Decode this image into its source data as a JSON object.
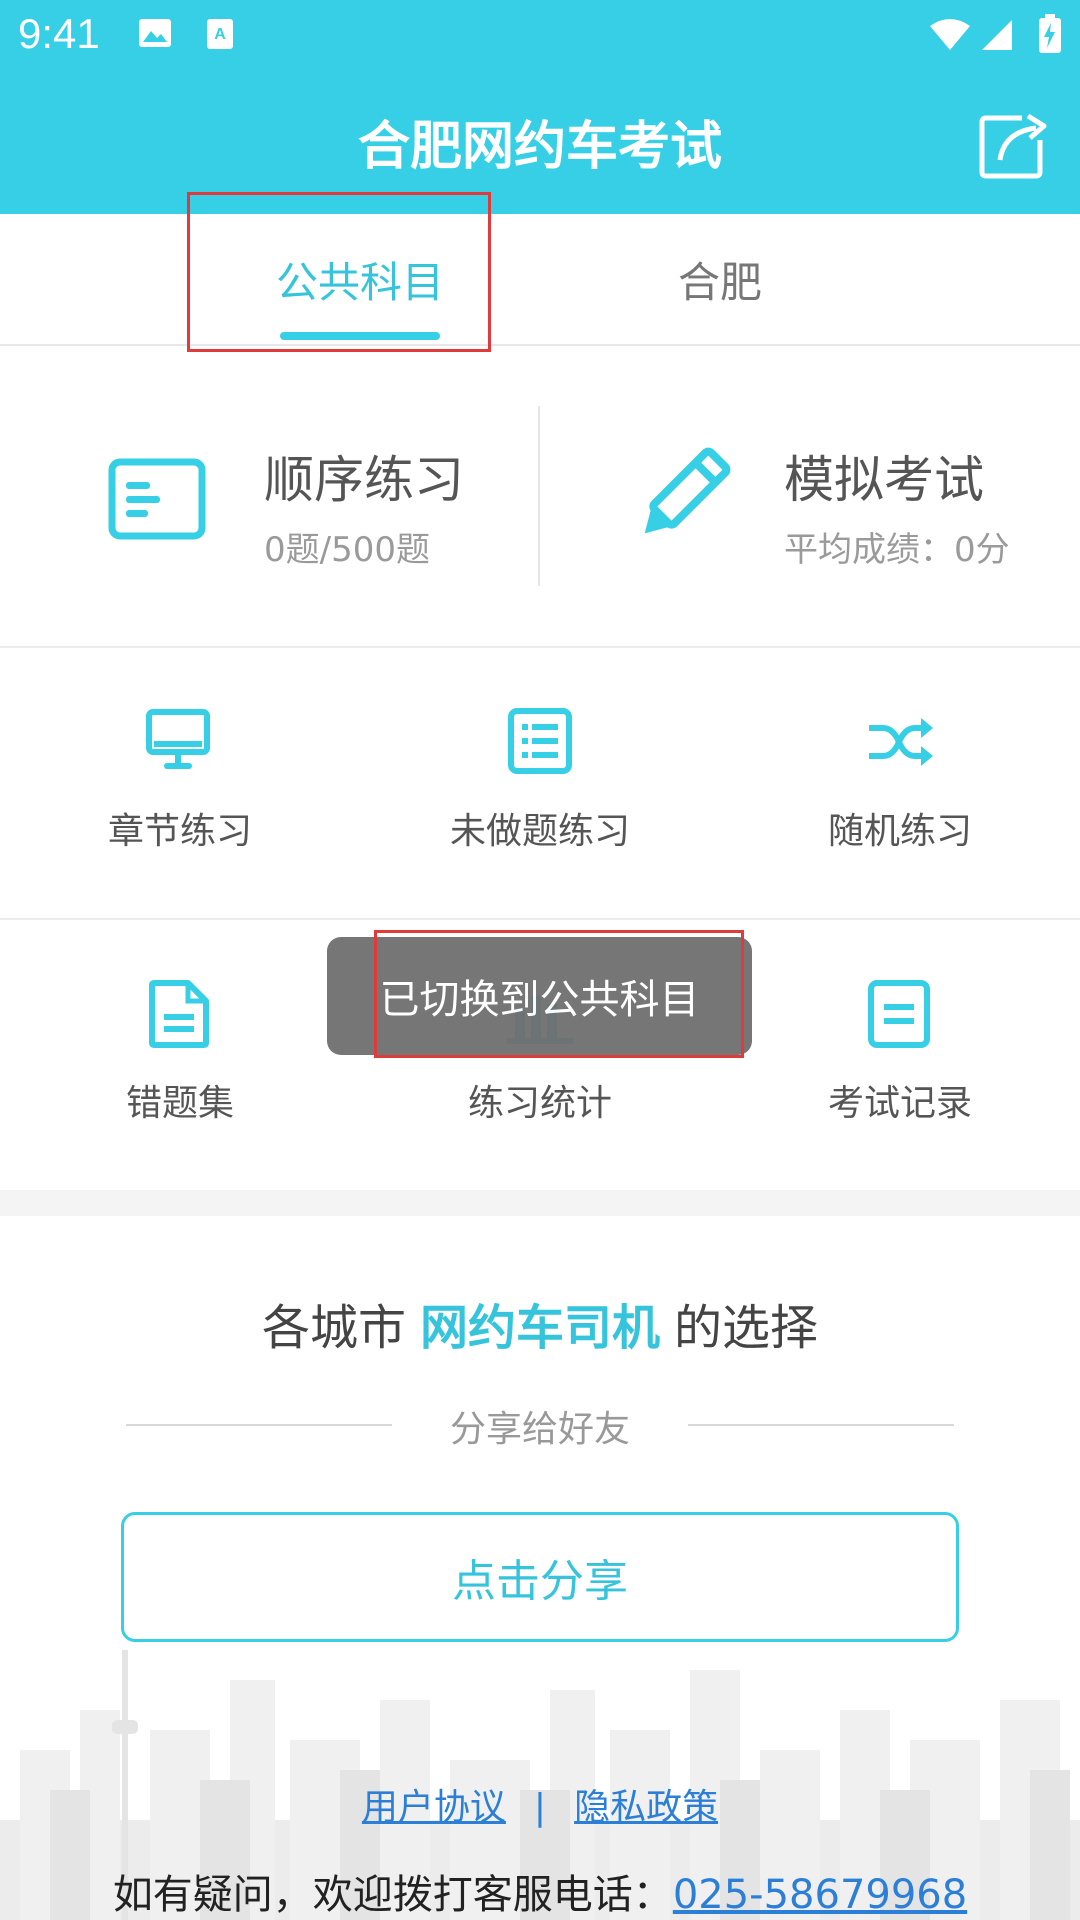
{
  "status_bar": {
    "time": "9:41"
  },
  "app": {
    "title": "合肥网约车考试"
  },
  "tabs": [
    {
      "label": "公共科目",
      "selected": true
    },
    {
      "label": "合肥",
      "selected": false
    }
  ],
  "features": {
    "sequential": {
      "title": "顺序练习",
      "sub": "0题/500题"
    },
    "mock": {
      "title": "模拟考试",
      "sub": "平均成绩：0分"
    }
  },
  "grid": {
    "chapter": "章节练习",
    "undone": "未做题练习",
    "random": "随机练习",
    "wrong": "错题集",
    "stats": "练习统计",
    "records": "考试记录"
  },
  "toast": "已切换到公共科目",
  "slogan": {
    "before": "各城市",
    "highlight": "网约车司机",
    "after": "的选择"
  },
  "share": {
    "caption": "分享给好友",
    "button": "点击分享"
  },
  "footer": {
    "user_agreement": "用户协议",
    "separator": "|",
    "privacy": "隐私政策",
    "contact_prefix": "如有疑问，欢迎拨打客服电话：",
    "phone": "025-58679968"
  },
  "colors": {
    "accent": "#36cfe6",
    "link": "#2b7fd6",
    "highlight_box": "#e03a3a"
  }
}
